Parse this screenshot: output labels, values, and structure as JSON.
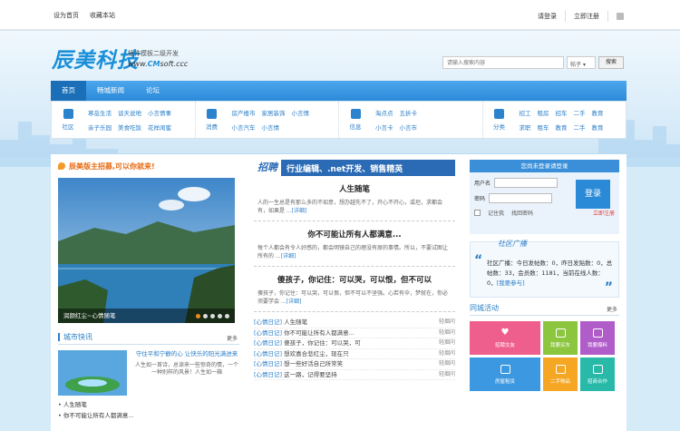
{
  "topbar": {
    "home": "设为首页",
    "bookmark": "收藏本站",
    "login": "请登录",
    "register": "立即注册"
  },
  "logo": {
    "text": "辰美科技",
    "tagline": "插件模板二级开发",
    "domain_prefix": "www.",
    "domain_mid": "CM",
    "domain_suffix": "soft.ccc"
  },
  "search": {
    "placeholder": "请输入搜索内容",
    "scope": "帖子",
    "button": "搜索"
  },
  "nav": [
    "首页",
    "畅城新闻",
    "论坛"
  ],
  "categories": [
    {
      "icon": "community-icon",
      "label": "社区",
      "links": [
        "寒岳生活",
        "谈天说地",
        "小言情事",
        "亲子乐园",
        "美食吃饭",
        "花样闺蜜"
      ]
    },
    {
      "icon": "shop-icon",
      "label": "消费",
      "links": [
        "房产楼市",
        "家居装饰",
        "小言情",
        "小言汽车",
        "小言情"
      ]
    },
    {
      "icon": "travel-icon",
      "label": "信息",
      "links": [
        "淘点点",
        "五折卡",
        "小言卡",
        "小言市"
      ]
    },
    {
      "icon": "classified-icon",
      "label": "分类",
      "links": [
        "招工",
        "租房",
        "招车",
        "二手",
        "教育",
        "求职",
        "租车",
        "教育",
        "二手",
        "教育"
      ]
    }
  ],
  "left": {
    "promo": "辰美版主招募,可以你就来!",
    "slide_caption": "润颜红尘~心情随笔",
    "section_title": "城市快讯",
    "section_more": "更多",
    "flash_title": "守住平和宁静的心 让快乐的阳光满进来",
    "flash_desc": "人生如一首诗，总读来一些惊奇的情，一个一种别样的风景！人生如一箱",
    "list": [
      "人生随笔",
      "你不可能让所有人都满意..."
    ]
  },
  "mid": {
    "banner_tag": "招聘",
    "banner_text": "行业编辑、.net开发、销售精英",
    "stories": [
      {
        "title": "人生随笔",
        "text": "人的一生总是有那么多的不如意，想办越先不了，开心不开心，或坦，求都会有，如果是 ...",
        "more": "[详细]"
      },
      {
        "title": "你不可能让所有人都满意...",
        "text": "每个人都会有令人好感的，都会明镜自己的理没有原的事情。所以，不要试图让所有的 ...",
        "more": "[详细]"
      },
      {
        "title": "傻孩子，你记住：可以哭，可以恨，但不可以",
        "text": "傻孩子，你记住：可以哭，可以恨，但不可以不坚强。心若有伞，梦就在，你必须要学会 ...",
        "more": "[详细]"
      }
    ],
    "list": [
      {
        "cat": "[心情日记]",
        "title": "人生随笔",
        "author": "轻烟问"
      },
      {
        "cat": "[心情日记]",
        "title": "你不可能让所有人都满意...",
        "author": "轻烟问"
      },
      {
        "cat": "[心情日记]",
        "title": "傻孩子，你记住：可以哭，可",
        "author": "轻烟问"
      },
      {
        "cat": "[心情日记]",
        "title": "想欢喜合悲红尘，现在只",
        "author": "轻烟问"
      },
      {
        "cat": "[心情日记]",
        "title": "想一些好活自己所常笑",
        "author": "轻烟问"
      },
      {
        "cat": "[心情日记]",
        "title": "这一路，记得要坚持",
        "author": "轻烟问"
      }
    ]
  },
  "right": {
    "login_header": "您尚未登录请登录",
    "user_label": "用户名",
    "pass_label": "密码",
    "login_btn": "登录",
    "remember": "记住我",
    "forgot": "找回密码",
    "register": "立即注册",
    "notice_title": "社区广播",
    "notice_line1": "社区广播：今日发帖数：0，昨日发贴数：0，总帖数：33，会员数：1181，当前在线人数：0，",
    "notice_link": "[我要参与]",
    "act_title": "同城活动",
    "act_more": "更多",
    "tiles": [
      {
        "label": "招聘交友",
        "color": "pink",
        "icon": "heart-icon"
      },
      {
        "label": "我要买车",
        "color": "green",
        "icon": "car-icon"
      },
      {
        "label": "我要爆料",
        "color": "purple",
        "icon": "chat-icon"
      },
      {
        "label": "房屋租赁",
        "color": "blue",
        "icon": "building-icon"
      },
      {
        "label": "二手物品",
        "color": "orange",
        "icon": "bag-icon"
      },
      {
        "label": "招商合作",
        "color": "teal",
        "icon": "people-icon"
      }
    ]
  },
  "colors": {
    "brand": "#1a8fd8",
    "nav": "#2b8ad8",
    "promo": "#e86a10"
  }
}
